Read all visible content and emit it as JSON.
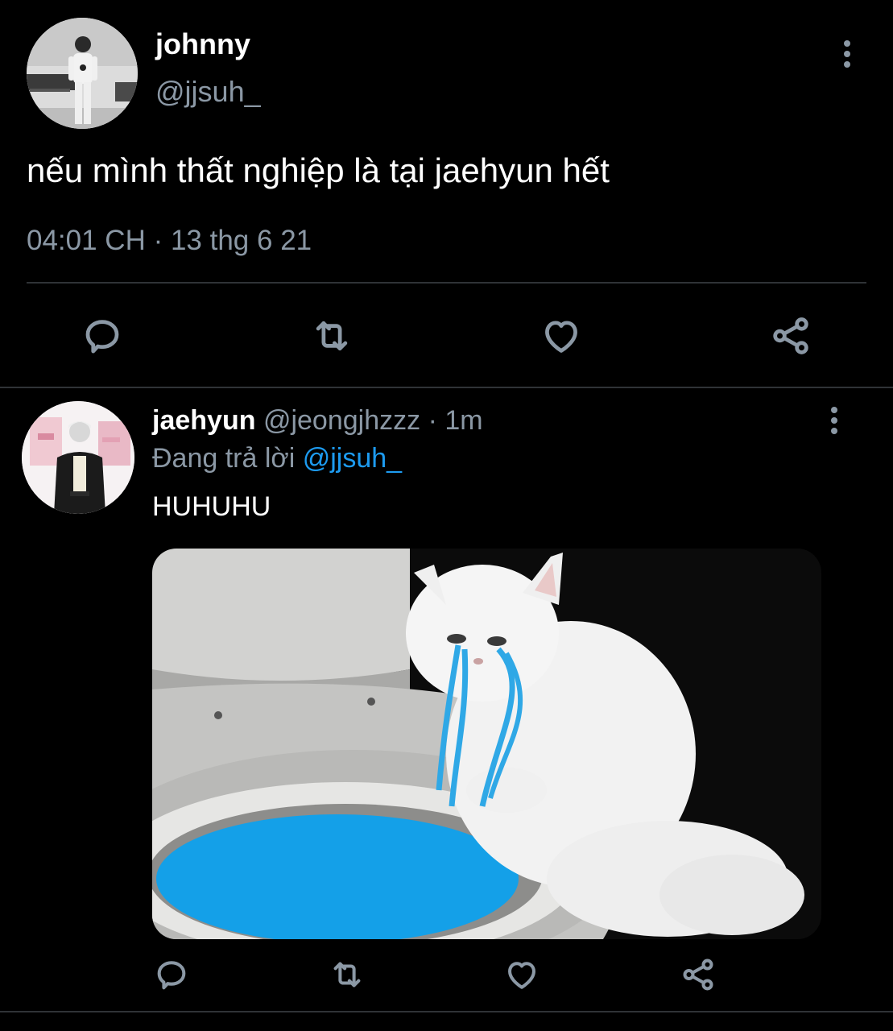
{
  "main_tweet": {
    "display_name": "johnny",
    "handle": "@jjsuh_",
    "text": "nếu mình thất nghiệp là tại jaehyun hết",
    "timestamp": "04:01 CH · 13 thg 6 21",
    "avatar_icon": "user-photo-avatar",
    "actions": [
      "reply-icon",
      "retweet-icon",
      "like-icon",
      "share-icon"
    ]
  },
  "reply_tweet": {
    "display_name": "jaehyun",
    "handle": "@jeongjhzzz",
    "separator": "·",
    "time": "1m",
    "replying_to_prefix": "Đang trả lời",
    "replying_to_handle": "@jjsuh_",
    "text": "HUHUHU",
    "media": "crying-white-cat-meme-image",
    "avatar_icon": "user-photo-avatar",
    "actions": [
      "reply-icon",
      "retweet-icon",
      "like-icon",
      "share-icon"
    ]
  },
  "colors": {
    "background": "#000000",
    "primary_text": "#ffffff",
    "secondary_text": "#8b98a5",
    "accent": "#1d9bf0",
    "divider": "#2f3336"
  }
}
